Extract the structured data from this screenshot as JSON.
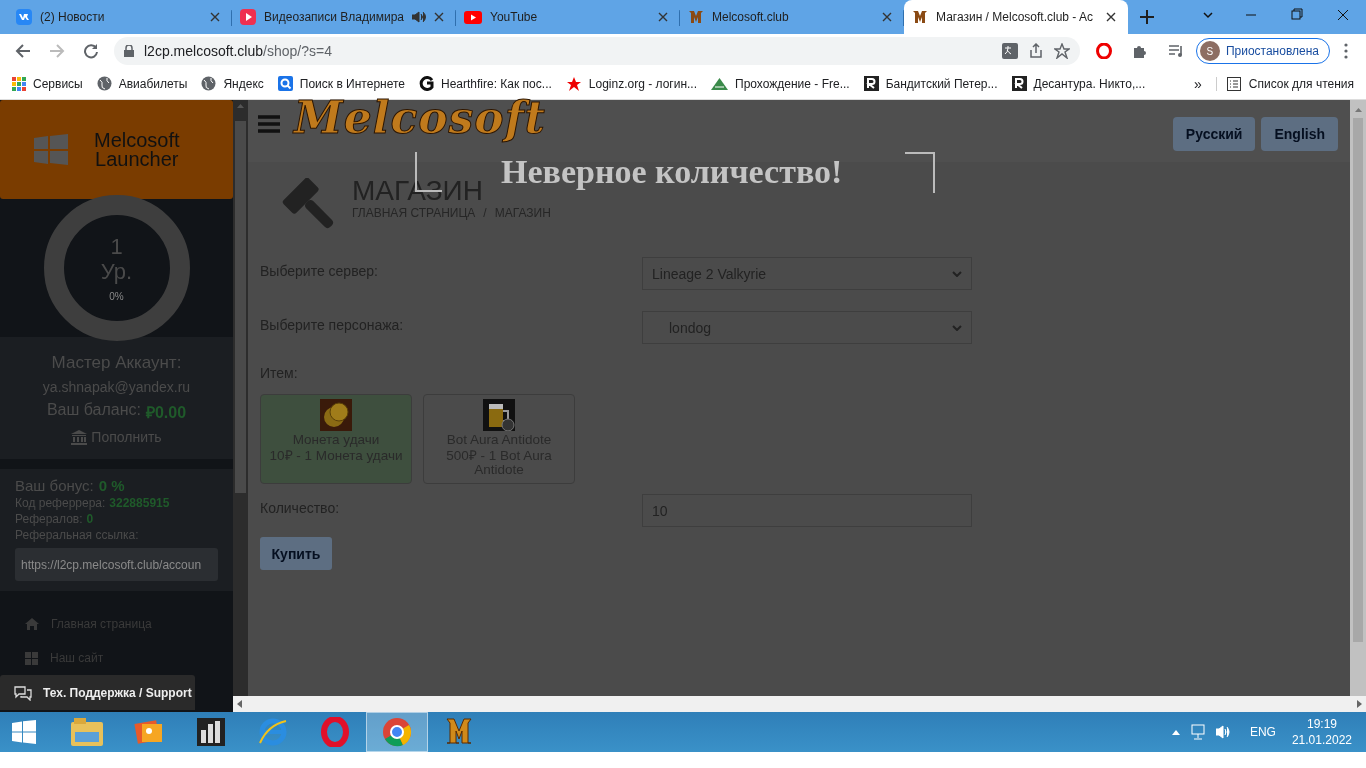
{
  "browser": {
    "tabs": [
      {
        "title": "(2) Новости",
        "kind": "vk",
        "audio": false,
        "selected": false
      },
      {
        "title": "Видеозаписи Владимира",
        "kind": "video",
        "audio": true,
        "selected": false
      },
      {
        "title": "YouTube",
        "kind": "youtube",
        "audio": false,
        "selected": false
      },
      {
        "title": "Melcosoft.club",
        "kind": "site",
        "audio": false,
        "selected": false
      },
      {
        "title": "Магазин / Melcosoft.club - Ac",
        "kind": "site",
        "audio": false,
        "selected": true
      }
    ],
    "address": {
      "host": "l2cp.melcosoft.club",
      "path": "/shop/?s=4"
    },
    "profile": {
      "initial": "S",
      "label": "Приостановлена"
    },
    "bookmarks": [
      {
        "title": "Сервисы",
        "kind": "apps"
      },
      {
        "title": "Авиабилеты",
        "kind": "globe"
      },
      {
        "title": "Яндекс",
        "kind": "globe"
      },
      {
        "title": "Поиск в Интернете",
        "kind": "search"
      },
      {
        "title": "Hearthfire: Как пос...",
        "kind": "g"
      },
      {
        "title": "Loginz.org - логин...",
        "kind": "star"
      },
      {
        "title": "Прохождение - Fre...",
        "kind": "mountain"
      },
      {
        "title": "Бандитский Петер...",
        "kind": "r"
      },
      {
        "title": "Десантура. Никто,...",
        "kind": "r"
      }
    ],
    "more_bookmarks": "»",
    "reading_list": "Список для чтения"
  },
  "sidebar": {
    "logo_lines": [
      "Melcosoft",
      "Launcher"
    ],
    "level": {
      "number": "1",
      "unit": "Ур.",
      "percent": "0%"
    },
    "account": {
      "title": "Мастер Аккаунт:",
      "email": "ya.shnapak@yandex.ru",
      "balance_label": "Ваш баланс:",
      "balance": "₽0.00",
      "topup": "Пополнить"
    },
    "bonus": {
      "label": "Ваш бонус:",
      "value": "0 %",
      "referrer_label": "Код реферрера:",
      "referrer_code": "322885915",
      "referrals_label": "Рефералов:",
      "referrals": "0",
      "link_label": "Реферальная ссылка:",
      "link": "https://l2cp.melcosoft.club/accoun"
    },
    "nav": [
      {
        "label": "Главная страница",
        "kind": "home"
      },
      {
        "label": "Наш сайт",
        "kind": "grid"
      }
    ],
    "support": "Тех. Поддержка / Support"
  },
  "header": {
    "logo": "Melcosoft",
    "languages": [
      "Русский",
      "English"
    ]
  },
  "alert": "Неверное количество!",
  "page": {
    "title": "МАГАЗИН",
    "breadcrumb": [
      "ГЛАВНАЯ СТРАНИЦА",
      "МАГАЗИН"
    ],
    "breadcrumb_separator": "/",
    "server": {
      "label": "Выберите сервер:",
      "value": "Lineage 2 Valkyrie"
    },
    "character": {
      "label": "Выберите персонажа:",
      "value": "londog"
    },
    "items_label": "Итем:",
    "items": [
      {
        "name": "Монета удачи",
        "price": "10₽ - 1 Монета удачи",
        "kind": "coin",
        "selected": true
      },
      {
        "name": "Bot Aura Antidote",
        "price": "500₽ - 1 Bot Aura Antidote",
        "kind": "beer",
        "selected": false
      }
    ],
    "quantity": {
      "label": "Количество:",
      "value": "10"
    },
    "buy": "Купить"
  },
  "taskbar": {
    "apps": [
      {
        "kind": "explorer",
        "selected": false
      },
      {
        "kind": "photos",
        "selected": false
      },
      {
        "kind": "columns",
        "selected": false
      },
      {
        "kind": "ie",
        "selected": false
      },
      {
        "kind": "opera",
        "selected": false
      },
      {
        "kind": "chrome",
        "selected": true
      },
      {
        "kind": "launcher",
        "selected": false
      }
    ],
    "language": "ENG",
    "time": "19:19",
    "date": "21.01.2022"
  }
}
